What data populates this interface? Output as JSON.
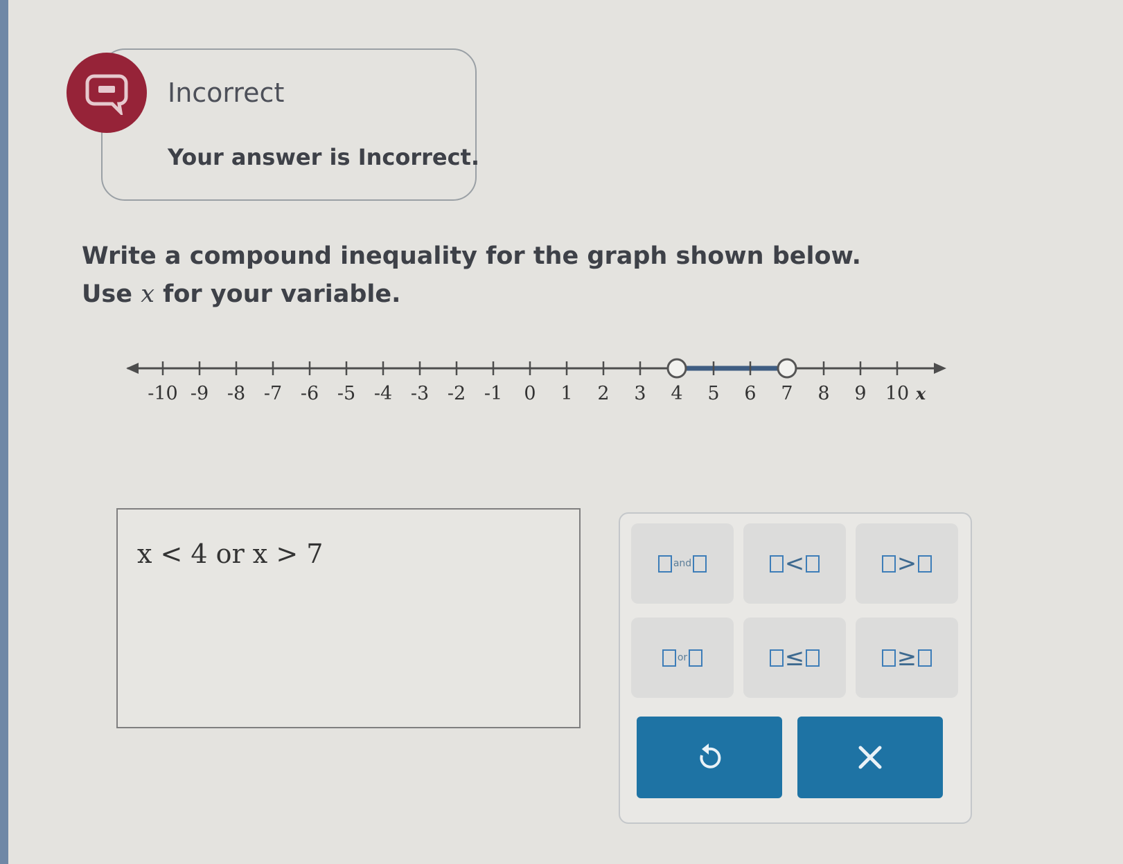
{
  "feedback": {
    "status": "Incorrect",
    "message": "Your answer is Incorrect.",
    "badge_icon": "speech-bubble-icon",
    "badge_color": "#962338"
  },
  "question": {
    "line1": "Write a compound inequality for the graph shown below.",
    "line2_pre": "Use ",
    "line2_var": "x",
    "line2_post": " for your variable."
  },
  "number_line": {
    "tick_labels": [
      "-10",
      "-9",
      "-8",
      "-7",
      "-6",
      "-5",
      "-4",
      "-3",
      "-2",
      "-1",
      "0",
      "1",
      "2",
      "3",
      "4",
      "5",
      "6",
      "7",
      "8",
      "9",
      "10"
    ],
    "axis_label": "x",
    "min": -10,
    "max": 10,
    "interval": {
      "from": 4,
      "to": 7,
      "left_endpoint": "open",
      "right_endpoint": "open"
    },
    "shade_color": "#3f5d82"
  },
  "answer": {
    "value": "x < 4 or x > 7"
  },
  "keypad": {
    "keys": [
      {
        "name": "and",
        "left": "",
        "op": "and",
        "right": ""
      },
      {
        "name": "less-than",
        "left": "",
        "op": "<",
        "right": ""
      },
      {
        "name": "greater-than",
        "left": "",
        "op": ">",
        "right": ""
      },
      {
        "name": "or",
        "left": "",
        "op": "or",
        "right": ""
      },
      {
        "name": "less-equal",
        "left": "",
        "op": "≤",
        "right": ""
      },
      {
        "name": "greater-equal",
        "left": "",
        "op": "≥",
        "right": ""
      }
    ],
    "undo_icon": "undo-icon",
    "clear_icon": "clear-icon",
    "button_color": "#1e73a4"
  }
}
